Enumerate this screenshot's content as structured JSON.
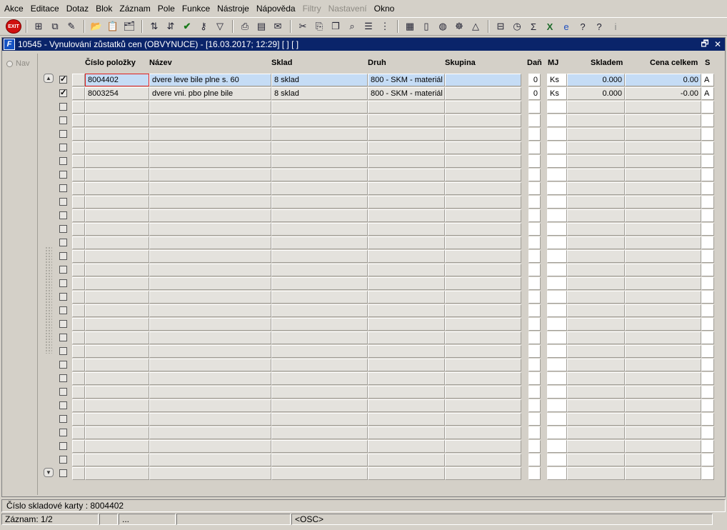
{
  "menu": [
    "Akce",
    "Editace",
    "Dotaz",
    "Blok",
    "Záznam",
    "Pole",
    "Funkce",
    "Nástroje",
    "Nápověda",
    "Filtry",
    "Nastavení",
    "Okno"
  ],
  "menu_disabled": [
    "Filtry",
    "Nastavení"
  ],
  "toolbar": {
    "exit_label": "EXIT"
  },
  "window": {
    "title": "10545 - Vynulování zůstatků cen (OBVYNUCE) - [16.03.2017; 12:29]  [ ]  [ ]",
    "logo": "F",
    "restore_glyph": "🗗",
    "close_glyph": "✕"
  },
  "nav": {
    "label": "Nav"
  },
  "columns": {
    "cislo": "Číslo položky",
    "nazev": "Název",
    "sklad": "Sklad",
    "druh": "Druh",
    "skupina": "Skupina",
    "dan": "Daň",
    "mj": "MJ",
    "skladem": "Skladem",
    "cena": "Cena celkem",
    "s": "S"
  },
  "rows": [
    {
      "checked": "✓",
      "cislo": "8004402",
      "nazev": "dvere leve bile plne s. 60",
      "sklad": "8  sklad",
      "druh": "800 - SKM - materiál",
      "skupina": "",
      "dan": "0",
      "mj": "Ks",
      "skladem": "0.000",
      "cena": "0.00",
      "s": "A"
    },
    {
      "checked": "✓",
      "cislo": "8003254",
      "nazev": "dvere vni. pbo plne bile",
      "sklad": "8  sklad",
      "druh": "800 - SKM - materiál",
      "skupina": "",
      "dan": "0",
      "mj": "Ks",
      "skladem": "0.000",
      "cena": "-0.00",
      "s": "A"
    }
  ],
  "status": {
    "field_info": "Číslo skladové karty : 8004402",
    "record": "Záznam: 1/2",
    "seg3": "...",
    "osc": "<OSC>"
  }
}
